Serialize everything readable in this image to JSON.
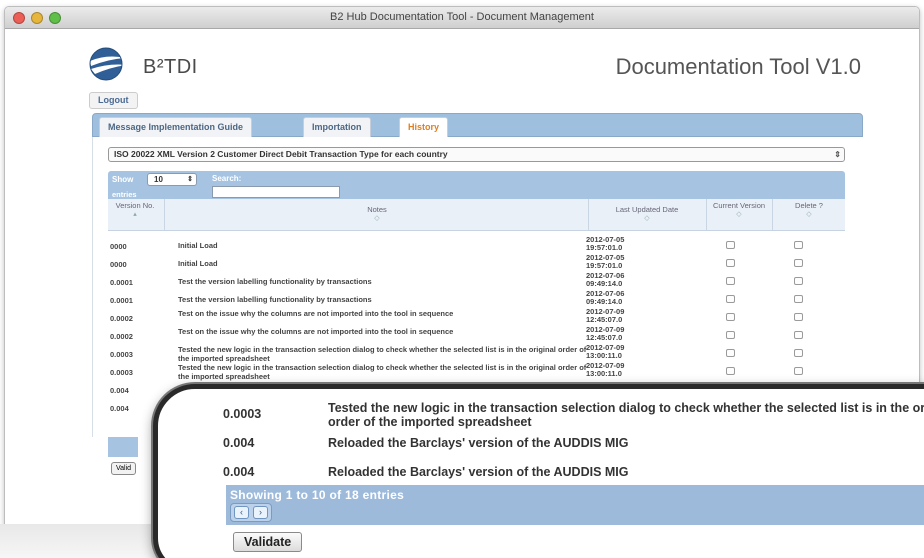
{
  "window": {
    "title": "B2 Hub Documentation Tool - Document Management"
  },
  "header": {
    "brand": "B²TDI",
    "app_title": "Documentation Tool V1.0"
  },
  "nav": {
    "logout_label": "Logout"
  },
  "tabs": [
    {
      "label": "Message Implementation Guide",
      "active": false
    },
    {
      "label": "Importation",
      "active": false
    },
    {
      "label": "History",
      "active": true
    }
  ],
  "transaction_select": {
    "value": "ISO 20022 XML Version 2 Customer Direct Debit Transaction Type for each country"
  },
  "table_controls": {
    "show_label": "Show",
    "entries_label": "entries",
    "page_length": "10",
    "search_label": "Search:"
  },
  "columns": {
    "version": "Version No.",
    "notes": "Notes",
    "date": "Last Updated Date",
    "current": "Current Version",
    "delete": "Delete ?"
  },
  "rows": [
    {
      "version": "0000",
      "notes": "Initial Load",
      "date": "2012-07-05 19:57:01.0"
    },
    {
      "version": "0000",
      "notes": "Initial Load",
      "date": "2012-07-05 19:57:01.0"
    },
    {
      "version": "0.0001",
      "notes": "Test the version labelling functionality by transactions",
      "date": "2012-07-06 09:49:14.0"
    },
    {
      "version": "0.0001",
      "notes": "Test the version labelling functionality by transactions",
      "date": "2012-07-06 09:49:14.0"
    },
    {
      "version": "0.0002",
      "notes": "Test on the issue why the columns are not imported into the tool in sequence",
      "date": "2012-07-09 12:45:07.0"
    },
    {
      "version": "0.0002",
      "notes": "Test on the issue why the columns are not imported into the tool in sequence",
      "date": "2012-07-09 12:45:07.0"
    },
    {
      "version": "0.0003",
      "notes": "Tested the new logic in the transaction selection dialog to check whether the selected list is in the original order of the imported spreadsheet",
      "date": "2012-07-09 13:00:11.0"
    },
    {
      "version": "0.0003",
      "notes": "Tested the new logic in the transaction selection dialog to check whether the selected list is in the original order of the imported spreadsheet",
      "date": "2012-07-09 13:00:11.0"
    },
    {
      "version": "0.004",
      "notes": "",
      "date": ""
    },
    {
      "version": "0.004",
      "notes": "",
      "date": ""
    }
  ],
  "zoom": {
    "rows": [
      {
        "version": "0.0003",
        "notes": "Tested the new logic in the transaction selection dialog to check whether the selected list is in the original order of the imported spreadsheet"
      },
      {
        "version": "0.004",
        "notes": "Reloaded the Barclays' version of the AUDDIS MIG"
      },
      {
        "version": "0.004",
        "notes": "Reloaded the Barclays' version of the AUDDIS MIG"
      }
    ],
    "info": "Showing 1 to 10 of 18 entries",
    "validate_label": "Validate"
  },
  "mini": {
    "validate_label": "Valid"
  },
  "colors": {
    "header_blue": "#a6c4e2",
    "active_tab": "#e07e20",
    "accent_text": "#4a6a95"
  },
  "icons": {
    "logo": "globe-swoosh-icon",
    "prev": "chevron-left-icon",
    "next": "chevron-right-icon"
  }
}
